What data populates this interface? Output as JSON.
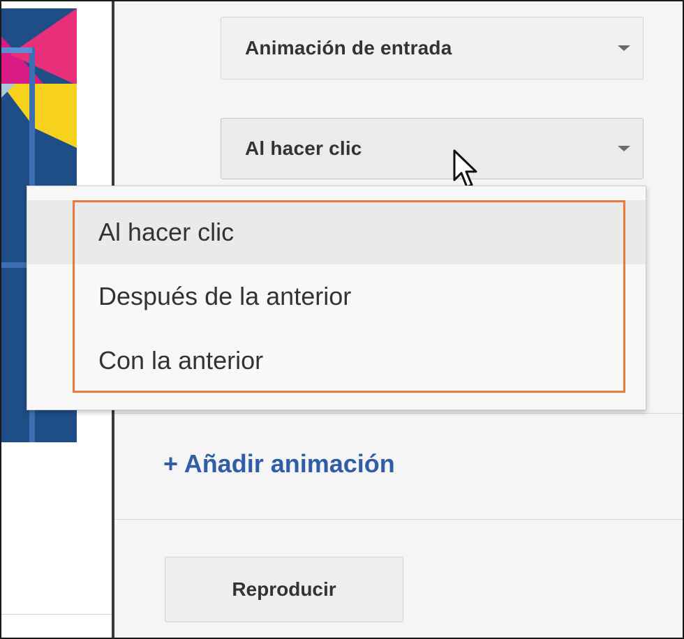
{
  "animation_panel": {
    "effect_select": {
      "value": "Animación de entrada"
    },
    "trigger_select": {
      "value": "Al hacer clic"
    },
    "trigger_options": [
      "Al hacer clic",
      "Después de la anterior",
      "Con la anterior"
    ],
    "add_animation_label": "+ Añadir animación",
    "play_button_label": "Reproducir"
  },
  "colors": {
    "highlight_border": "#ea7a3c",
    "link": "#2f5da8",
    "thumbnail_bg": "#1f4e86"
  },
  "icons": [
    "dropdown-caret-icon",
    "mouse-pointer-icon"
  ]
}
